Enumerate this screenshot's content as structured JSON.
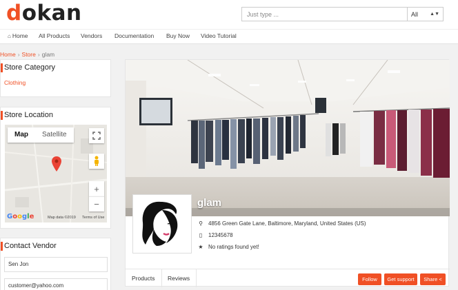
{
  "header": {
    "logo_first": "d",
    "logo_rest": "okan",
    "search_placeholder": "Just type ...",
    "search_category": "All"
  },
  "nav": {
    "items": [
      "Home",
      "All Products",
      "Vendors",
      "Documentation",
      "Buy Now",
      "Video Tutorial"
    ]
  },
  "breadcrumb": {
    "home": "Home",
    "store": "Store",
    "current": "glam"
  },
  "sidebar": {
    "category": {
      "title": "Store Category",
      "items": [
        "Clothing"
      ]
    },
    "location": {
      "title": "Store Location",
      "map_tabs": [
        "Map",
        "Satellite"
      ],
      "map_data": "Map data ©2019",
      "terms": "Terms of Use",
      "zoom_in": "+",
      "zoom_out": "−"
    },
    "contact": {
      "title": "Contact Vendor",
      "name_value": "Sen Jon",
      "email_value": "customer@yahoo.com"
    }
  },
  "store": {
    "name": "glam",
    "address": "4856 Green Gate Lane, Baltimore, Maryland, United States (US)",
    "phone": "12345678",
    "rating": "No ratings found yet!",
    "tabs": [
      "Products",
      "Reviews"
    ],
    "buttons": {
      "follow": "Follow",
      "support": "Get support",
      "share": "Share"
    }
  },
  "colors": {
    "accent": "#f05025"
  }
}
